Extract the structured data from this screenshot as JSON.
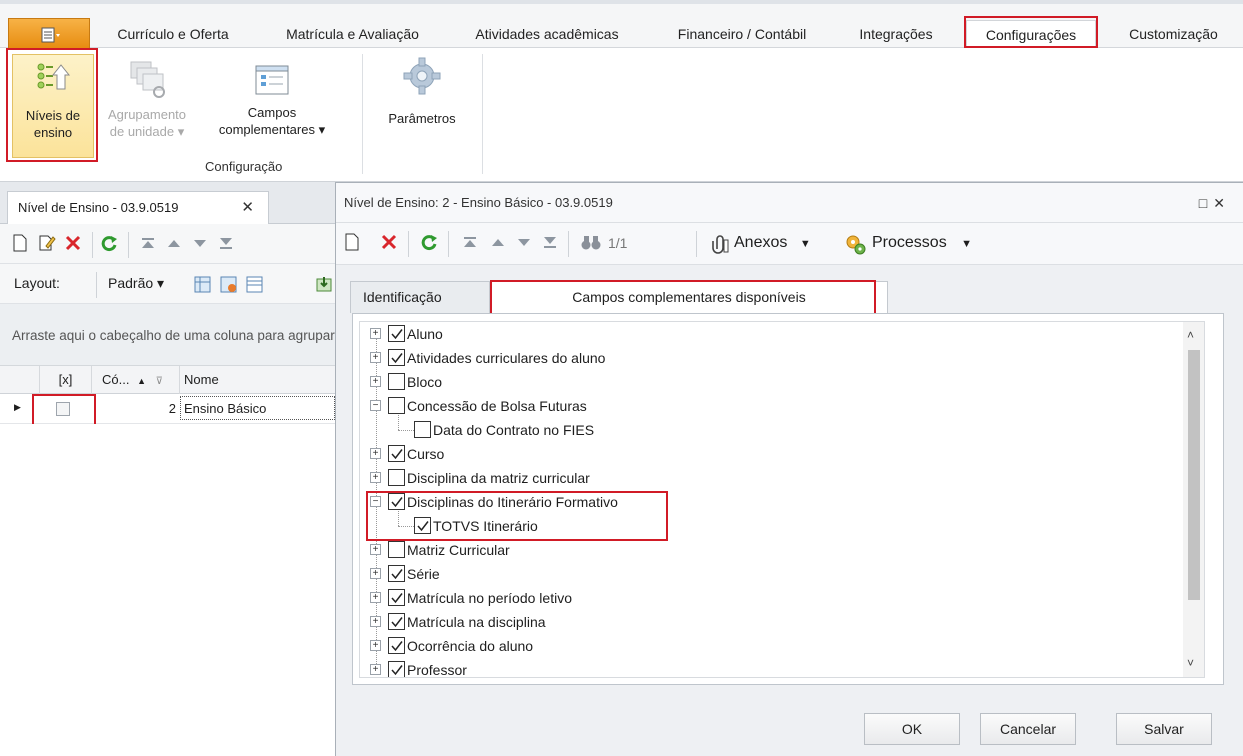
{
  "ribbon": {
    "tabs": [
      {
        "label": "Currículo e Oferta"
      },
      {
        "label": "Matrícula e Avaliação"
      },
      {
        "label": "Atividades acadêmicas"
      },
      {
        "label": "Financeiro / Contábil"
      },
      {
        "label": "Integrações"
      },
      {
        "label": "Configurações",
        "active": true
      },
      {
        "label": "Customização"
      }
    ],
    "buttons": {
      "niveis": {
        "line1": "Níveis de",
        "line2": "ensino"
      },
      "agrupamento": {
        "line1": "Agrupamento",
        "line2": "de unidade ▾"
      },
      "campos": {
        "line1": "Campos",
        "line2": "complementares ▾"
      },
      "parametros": {
        "line1": "Parâmetros"
      }
    },
    "group_label": "Configuração"
  },
  "left_panel": {
    "doc_tab_title": "Nível de Ensino - 03.9.0519",
    "layout_label": "Layout:",
    "layout_value": "Padrão ▾",
    "group_hint": "Arraste aqui o cabeçalho de uma coluna para agrupar",
    "columns": {
      "check": "[x]",
      "code": "Có...",
      "name": "Nome"
    },
    "rows": [
      {
        "code": "2",
        "name": "Ensino Básico",
        "checked": false
      }
    ]
  },
  "dialog": {
    "title": "Nível de Ensino: 2 - Ensino Básico - 03.9.0519",
    "toolbar": {
      "record_counter": "1/1",
      "attachments": "Anexos",
      "processes": "Processos"
    },
    "tabs": [
      {
        "label": "Identificação"
      },
      {
        "label": "Campos complementares disponíveis",
        "active": true
      }
    ],
    "tree": [
      {
        "label": "Aluno",
        "checked": true,
        "expander": "+",
        "level": 0
      },
      {
        "label": "Atividades curriculares do aluno",
        "checked": true,
        "expander": "+",
        "level": 0
      },
      {
        "label": "Bloco",
        "checked": false,
        "expander": "+",
        "level": 0
      },
      {
        "label": "Concessão de Bolsa Futuras",
        "checked": false,
        "expander": "−",
        "level": 0
      },
      {
        "label": "Data do Contrato no FIES",
        "checked": false,
        "expander": "",
        "level": 1
      },
      {
        "label": "Curso",
        "checked": true,
        "expander": "+",
        "level": 0
      },
      {
        "label": "Disciplina da matriz curricular",
        "checked": false,
        "expander": "+",
        "level": 0
      },
      {
        "label": "Disciplinas do Itinerário Formativo",
        "checked": true,
        "expander": "−",
        "level": 0
      },
      {
        "label": "TOTVS Itinerário",
        "checked": true,
        "expander": "",
        "level": 1
      },
      {
        "label": "Matriz Curricular",
        "checked": false,
        "expander": "+",
        "level": 0
      },
      {
        "label": "Série",
        "checked": true,
        "expander": "+",
        "level": 0
      },
      {
        "label": "Matrícula no período letivo",
        "checked": true,
        "expander": "+",
        "level": 0
      },
      {
        "label": "Matrícula na disciplina",
        "checked": true,
        "expander": "+",
        "level": 0
      },
      {
        "label": "Ocorrência do aluno",
        "checked": true,
        "expander": "+",
        "level": 0
      },
      {
        "label": "Professor",
        "checked": true,
        "expander": "+",
        "level": 0
      }
    ],
    "buttons": {
      "ok": "OK",
      "cancel": "Cancelar",
      "save": "Salvar"
    }
  },
  "colors": {
    "highlight": "#d11b26",
    "accent_orange": "#e68a0d"
  }
}
